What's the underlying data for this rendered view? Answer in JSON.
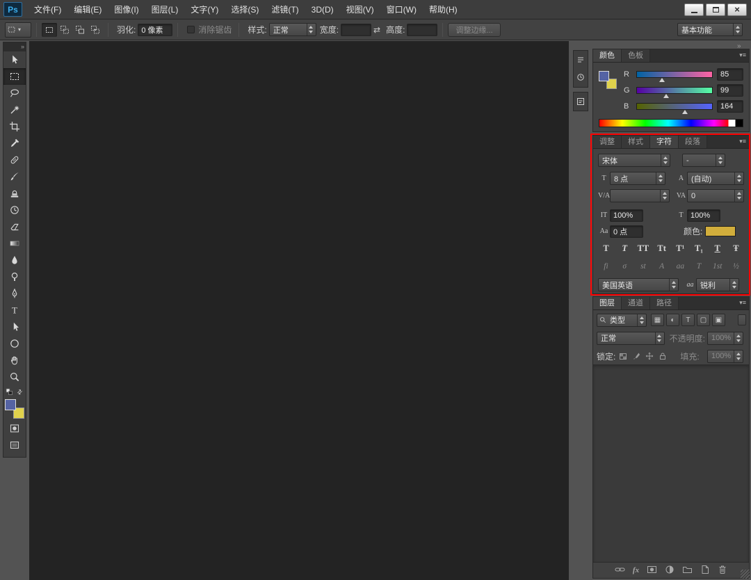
{
  "app": {
    "logo": "Ps",
    "caret_icon": "▾",
    "collapse_icon": "»",
    "panel_menu_icon": "▾≡",
    "close_icon": "×"
  },
  "menu_bar": {
    "items": [
      "文件(F)",
      "编辑(E)",
      "图像(I)",
      "图层(L)",
      "文字(Y)",
      "选择(S)",
      "滤镜(T)",
      "3D(D)",
      "视图(V)",
      "窗口(W)",
      "帮助(H)"
    ]
  },
  "options_bar": {
    "feather_label": "羽化:",
    "feather_value": "0 像素",
    "antialias_label": "消除锯齿",
    "style_label": "样式:",
    "style_value": "正常",
    "width_label": "宽度:",
    "width_value": "",
    "swap_icon": "⇄",
    "height_label": "高度:",
    "height_value": "",
    "refine_edge_label": "调整边缘...",
    "workspace_label": "基本功能"
  },
  "toolbar": {
    "tools": [
      "move-tool",
      "rectangular-marquee-tool",
      "lasso-tool",
      "magic-wand-tool",
      "crop-tool",
      "eyedropper-tool",
      "spot-healing-brush-tool",
      "brush-tool",
      "clone-stamp-tool",
      "history-brush-tool",
      "eraser-tool",
      "gradient-tool",
      "blur-tool",
      "dodge-tool",
      "pen-tool",
      "type-tool",
      "path-selection-tool",
      "shape-tool",
      "hand-tool",
      "zoom-tool"
    ],
    "active_tool": "rectangular-marquee-tool",
    "foreground_color": "#5563a4",
    "background_color": "#e0d24c"
  },
  "color_panel": {
    "tabs": [
      "颜色",
      "色板"
    ],
    "active_tab": "颜色",
    "channels": [
      {
        "label": "R",
        "value": "85"
      },
      {
        "label": "G",
        "value": "99"
      },
      {
        "label": "B",
        "value": "164"
      }
    ],
    "foreground_color": "#5563a4",
    "background_color": "#e0d24c"
  },
  "character_panel": {
    "tabs": [
      "调整",
      "样式",
      "字符",
      "段落"
    ],
    "active_tab": "字符",
    "font_family": "宋体",
    "font_style": "-",
    "size_icon": "T",
    "size_value": "8 点",
    "leading_icon": "A",
    "leading_value": "(自动)",
    "kerning_icon": "V/A",
    "kerning_value": "",
    "tracking_icon": "VA",
    "tracking_value": "0",
    "vertical_scale_icon": "IT",
    "vertical_scale_value": "100%",
    "horizontal_scale_icon": "T",
    "horizontal_scale_value": "100%",
    "baseline_icon": "Aa",
    "baseline_value": "0 点",
    "color_label": "颜色:",
    "text_color": "#d2ae3c",
    "style_buttons": [
      "T",
      "T",
      "TT",
      "Tt",
      "T¹",
      "T₁",
      "T",
      "Ŧ"
    ],
    "opentype_buttons": [
      "fi",
      "σ",
      "st",
      "A",
      "aa",
      "T",
      "1st",
      "½"
    ],
    "language_value": "美国英语",
    "antialias_label": "aa",
    "antialias_value": "锐利"
  },
  "layers_panel": {
    "tabs": [
      "图层",
      "通道",
      "路径"
    ],
    "active_tab": "图层",
    "filter_value": "类型",
    "filter_buttons": [
      "▦",
      "◐",
      "T",
      "▢",
      "▣"
    ],
    "blend_value": "正常",
    "opacity_label": "不透明度:",
    "opacity_value": "100%",
    "lock_label": "锁定:",
    "fill_label": "填充:",
    "fill_value": "100%",
    "fx_icon": "fx"
  },
  "highlight": {
    "color": "#ff0000"
  }
}
